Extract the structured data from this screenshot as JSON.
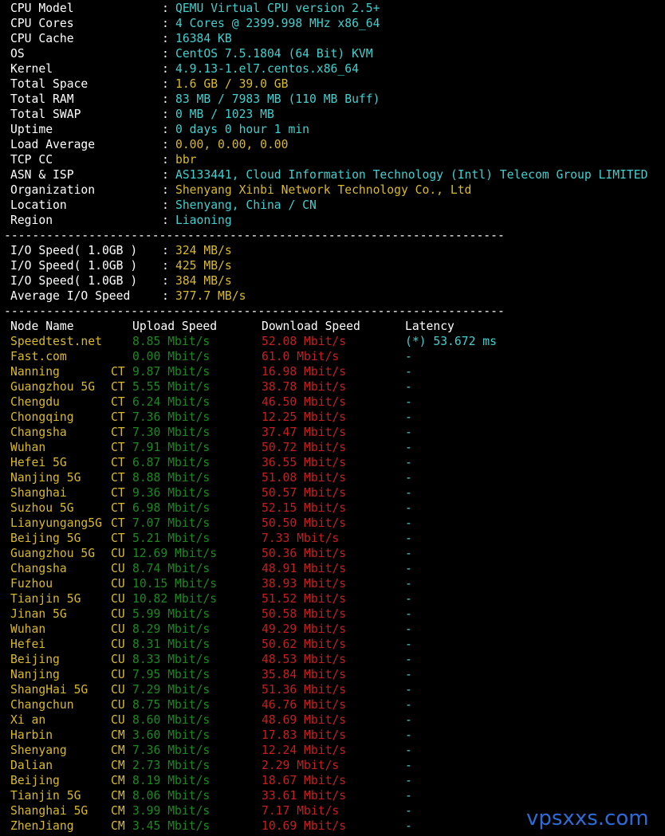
{
  "colors": {
    "background": "#000000",
    "label": "#ffffff",
    "cyan": "#3fd0cf",
    "yellow": "#d8b92a",
    "green": "#1a8a1e",
    "red": "#c81e1e",
    "watermark": "#2e6bd6"
  },
  "sysinfo": [
    {
      "label": "CPU Model",
      "value": "QEMU Virtual CPU version 2.5+",
      "color": "cyan"
    },
    {
      "label": "CPU Cores",
      "value": "4 Cores @ 2399.998 MHz x86_64",
      "color": "cyan"
    },
    {
      "label": "CPU Cache",
      "value": "16384 KB",
      "color": "cyan"
    },
    {
      "label": "OS",
      "value": "CentOS 7.5.1804 (64 Bit) KVM",
      "color": "cyan"
    },
    {
      "label": "Kernel",
      "value": "4.9.13-1.el7.centos.x86_64",
      "color": "cyan"
    },
    {
      "label": "Total Space",
      "value": "1.6 GB / 39.0 GB",
      "color": "yellow"
    },
    {
      "label": "Total RAM",
      "value": "83 MB / 7983 MB (110 MB Buff)",
      "color": "cyan"
    },
    {
      "label": "Total SWAP",
      "value": "0 MB / 1023 MB",
      "color": "cyan"
    },
    {
      "label": "Uptime",
      "value": "0 days 0 hour 1 min",
      "color": "cyan"
    },
    {
      "label": "Load Average",
      "value": "0.00, 0.00, 0.00",
      "color": "yellow"
    },
    {
      "label": "TCP CC",
      "value": "bbr",
      "color": "yellow"
    },
    {
      "label": "ASN & ISP",
      "value": "AS133441, Cloud Information Technology (Intl) Telecom Group LIMITED",
      "color": "cyan"
    },
    {
      "label": "Organization",
      "value": "Shenyang Xinbi Network Technology Co., Ltd",
      "color": "yellow"
    },
    {
      "label": "Location",
      "value": "Shenyang, China / CN",
      "color": "cyan"
    },
    {
      "label": "Region",
      "value": "Liaoning",
      "color": "cyan"
    }
  ],
  "separator": "-----------------------------------------------------------------------",
  "io": [
    {
      "label": "I/O Speed( 1.0GB )",
      "value": "324 MB/s"
    },
    {
      "label": "I/O Speed( 1.0GB )",
      "value": "425 MB/s"
    },
    {
      "label": "I/O Speed( 1.0GB )",
      "value": "384 MB/s"
    },
    {
      "label": "Average I/O Speed",
      "value": "377.7 MB/s"
    }
  ],
  "speedtest": {
    "headers": {
      "node": "Node Name",
      "upload": "Upload Speed",
      "download": "Download Speed",
      "latency": "Latency"
    },
    "rows": [
      {
        "node": "Speedtest.net",
        "isp": "",
        "upload": "8.85 Mbit/s",
        "download": "52.08 Mbit/s",
        "latency": "(*) 53.672 ms"
      },
      {
        "node": "Fast.com",
        "isp": "",
        "upload": "0.00 Mbit/s",
        "download": "61.0 Mbit/s",
        "latency": "-"
      },
      {
        "node": "Nanning",
        "isp": "CT",
        "upload": "9.87 Mbit/s",
        "download": "16.98 Mbit/s",
        "latency": "-"
      },
      {
        "node": "Guangzhou 5G",
        "isp": "CT",
        "upload": "5.55 Mbit/s",
        "download": "38.78 Mbit/s",
        "latency": "-"
      },
      {
        "node": "Chengdu",
        "isp": "CT",
        "upload": "6.24 Mbit/s",
        "download": "46.50 Mbit/s",
        "latency": "-"
      },
      {
        "node": "Chongqing",
        "isp": "CT",
        "upload": "7.36 Mbit/s",
        "download": "12.25 Mbit/s",
        "latency": "-"
      },
      {
        "node": "Changsha",
        "isp": "CT",
        "upload": "7.30 Mbit/s",
        "download": "37.47 Mbit/s",
        "latency": "-"
      },
      {
        "node": "Wuhan",
        "isp": "CT",
        "upload": "7.91 Mbit/s",
        "download": "50.72 Mbit/s",
        "latency": "-"
      },
      {
        "node": "Hefei 5G",
        "isp": "CT",
        "upload": "6.87 Mbit/s",
        "download": "36.55 Mbit/s",
        "latency": "-"
      },
      {
        "node": "Nanjing 5G",
        "isp": "CT",
        "upload": "8.88 Mbit/s",
        "download": "51.08 Mbit/s",
        "latency": "-"
      },
      {
        "node": "Shanghai",
        "isp": "CT",
        "upload": "9.36 Mbit/s",
        "download": "50.57 Mbit/s",
        "latency": "-"
      },
      {
        "node": "Suzhou 5G",
        "isp": "CT",
        "upload": "6.98 Mbit/s",
        "download": "52.15 Mbit/s",
        "latency": "-"
      },
      {
        "node": "Lianyungang5G",
        "isp": "CT",
        "upload": "7.07 Mbit/s",
        "download": "50.50 Mbit/s",
        "latency": "-"
      },
      {
        "node": "Beijing 5G",
        "isp": "CT",
        "upload": "5.21 Mbit/s",
        "download": "7.33 Mbit/s",
        "latency": "-"
      },
      {
        "node": "Guangzhou 5G",
        "isp": "CU",
        "upload": "12.69 Mbit/s",
        "download": "50.36 Mbit/s",
        "latency": "-"
      },
      {
        "node": "Changsha",
        "isp": "CU",
        "upload": "8.74 Mbit/s",
        "download": "48.91 Mbit/s",
        "latency": "-"
      },
      {
        "node": "Fuzhou",
        "isp": "CU",
        "upload": "10.15 Mbit/s",
        "download": "38.93 Mbit/s",
        "latency": "-"
      },
      {
        "node": "Tianjin 5G",
        "isp": "CU",
        "upload": "10.82 Mbit/s",
        "download": "51.52 Mbit/s",
        "latency": "-"
      },
      {
        "node": "Jinan 5G",
        "isp": "CU",
        "upload": "5.99 Mbit/s",
        "download": "50.58 Mbit/s",
        "latency": "-"
      },
      {
        "node": "Wuhan",
        "isp": "CU",
        "upload": "8.29 Mbit/s",
        "download": "49.29 Mbit/s",
        "latency": "-"
      },
      {
        "node": "Hefei",
        "isp": "CU",
        "upload": "8.31 Mbit/s",
        "download": "50.62 Mbit/s",
        "latency": "-"
      },
      {
        "node": "Beijing",
        "isp": "CU",
        "upload": "8.33 Mbit/s",
        "download": "48.53 Mbit/s",
        "latency": "-"
      },
      {
        "node": "Nanjing",
        "isp": "CU",
        "upload": "7.95 Mbit/s",
        "download": "35.84 Mbit/s",
        "latency": "-"
      },
      {
        "node": "ShangHai 5G",
        "isp": "CU",
        "upload": "7.29 Mbit/s",
        "download": "51.36 Mbit/s",
        "latency": "-"
      },
      {
        "node": "Changchun",
        "isp": "CU",
        "upload": "8.75 Mbit/s",
        "download": "46.76 Mbit/s",
        "latency": "-"
      },
      {
        "node": "Xi an",
        "isp": "CU",
        "upload": "8.60 Mbit/s",
        "download": "48.69 Mbit/s",
        "latency": "-"
      },
      {
        "node": "Harbin",
        "isp": "CM",
        "upload": "3.60 Mbit/s",
        "download": "17.83 Mbit/s",
        "latency": "-"
      },
      {
        "node": "Shenyang",
        "isp": "CM",
        "upload": "7.36 Mbit/s",
        "download": "12.24 Mbit/s",
        "latency": "-"
      },
      {
        "node": "Dalian",
        "isp": "CM",
        "upload": "2.73 Mbit/s",
        "download": "2.29 Mbit/s",
        "latency": "-"
      },
      {
        "node": "Beijing",
        "isp": "CM",
        "upload": "8.19 Mbit/s",
        "download": "18.67 Mbit/s",
        "latency": "-"
      },
      {
        "node": "Tianjin 5G",
        "isp": "CM",
        "upload": "8.06 Mbit/s",
        "download": "33.61 Mbit/s",
        "latency": "-"
      },
      {
        "node": "Shanghai 5G",
        "isp": "CM",
        "upload": "3.99 Mbit/s",
        "download": "7.17 Mbit/s",
        "latency": "-"
      },
      {
        "node": "ZhenJiang",
        "isp": "CM",
        "upload": "3.45 Mbit/s",
        "download": "10.69 Mbit/s",
        "latency": "-"
      }
    ]
  },
  "watermark": "vpsxxs.com"
}
